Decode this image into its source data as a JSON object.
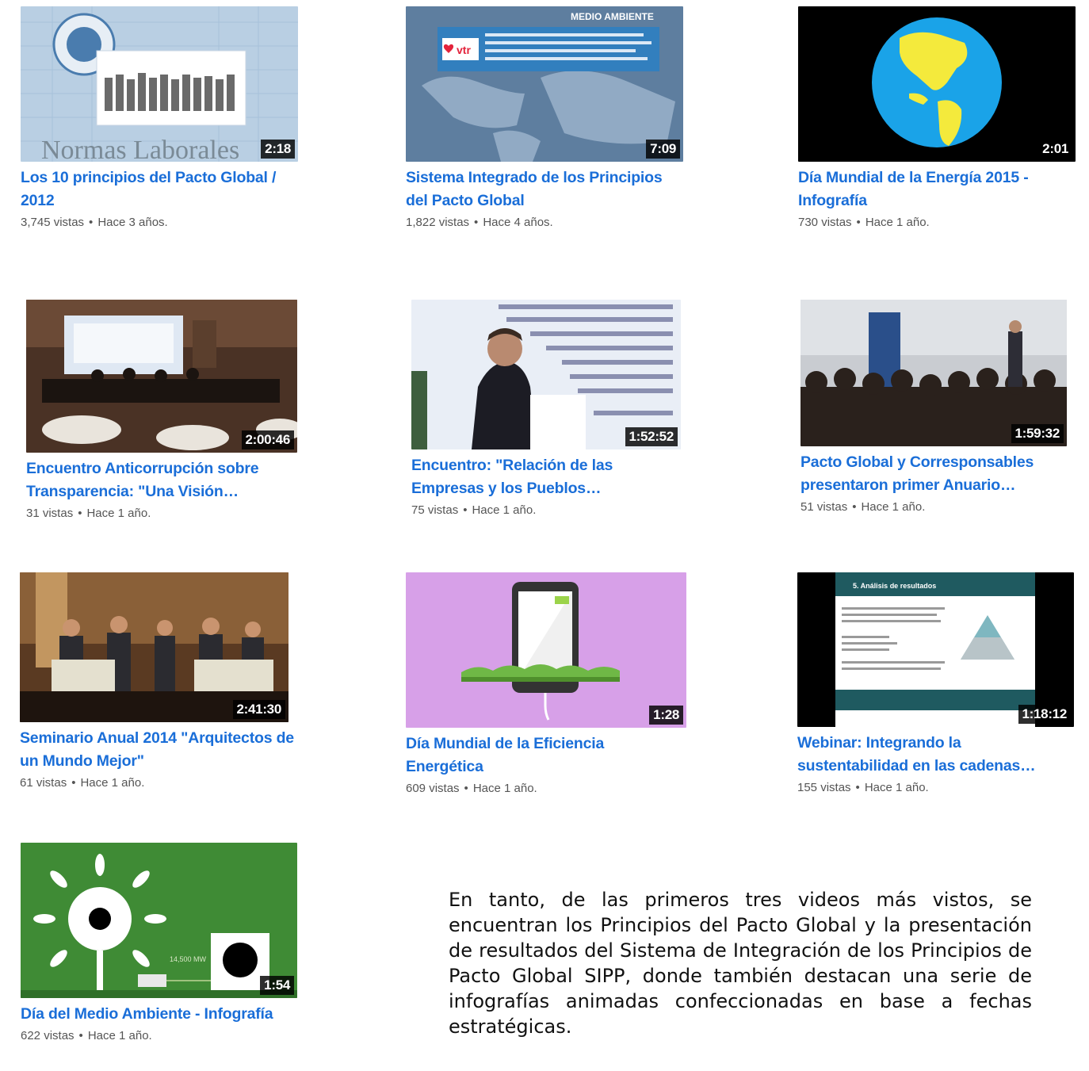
{
  "videos": [
    {
      "title": "Los 10 principios del Pacto Global / 2012",
      "duration": "2:18",
      "views": "3,745 vistas",
      "age": "Hace 3 años.",
      "overlay_text": "Normas Laborales"
    },
    {
      "title": "Sistema Integrado de los Principios del Pacto Global",
      "duration": "7:09",
      "views": "1,822 vistas",
      "age": "Hace 4 años.",
      "overlay_text": "MEDIO AMBIENTE",
      "brand": "vtr"
    },
    {
      "title": "Día Mundial de la Energía 2015 - Infografía",
      "duration": "2:01",
      "views": "730 vistas",
      "age": "Hace 1 año."
    },
    {
      "title": "Encuentro Anticorrupción sobre Transparencia: \"Una Visión…",
      "duration": "2:00:46",
      "views": "31 vistas",
      "age": "Hace 1 año."
    },
    {
      "title": "Encuentro: \"Relación de las Empresas y los Pueblos…",
      "duration": "1:52:52",
      "views": "75 vistas",
      "age": "Hace 1 año."
    },
    {
      "title": "Pacto Global y Corresponsables presentaron primer Anuario…",
      "duration": "1:59:32",
      "views": "51 vistas",
      "age": "Hace 1 año."
    },
    {
      "title": "Seminario Anual 2014 \"Arquitectos de un Mundo Mejor\"",
      "duration": "2:41:30",
      "views": "61 vistas",
      "age": "Hace 1 año."
    },
    {
      "title": "Día Mundial de la Eficiencia Energética",
      "duration": "1:28",
      "views": "609 vistas",
      "age": "Hace 1 año."
    },
    {
      "title": "Webinar: Integrando la sustentabilidad en las cadenas…",
      "duration": "1:18:12",
      "views": "155 vistas",
      "age": "Hace 1 año.",
      "overlay_text": "5. Análisis de resultados"
    },
    {
      "title": "Día del Medio Ambiente - Infografía",
      "duration": "1:54",
      "views": "622 vistas",
      "age": "Hace 1 año.",
      "overlay_text": "14,500 MW"
    }
  ],
  "meta_separator": "•",
  "paragraph": "En tanto, de las primeros tres videos más vistos, se encuentran los Principios del Pacto Global y la presentación de resultados del Sistema de Integración de los Principios de Pacto Global SIPP, donde también destacan una serie de infografías animadas confeccionadas en base a fechas estratégicas."
}
